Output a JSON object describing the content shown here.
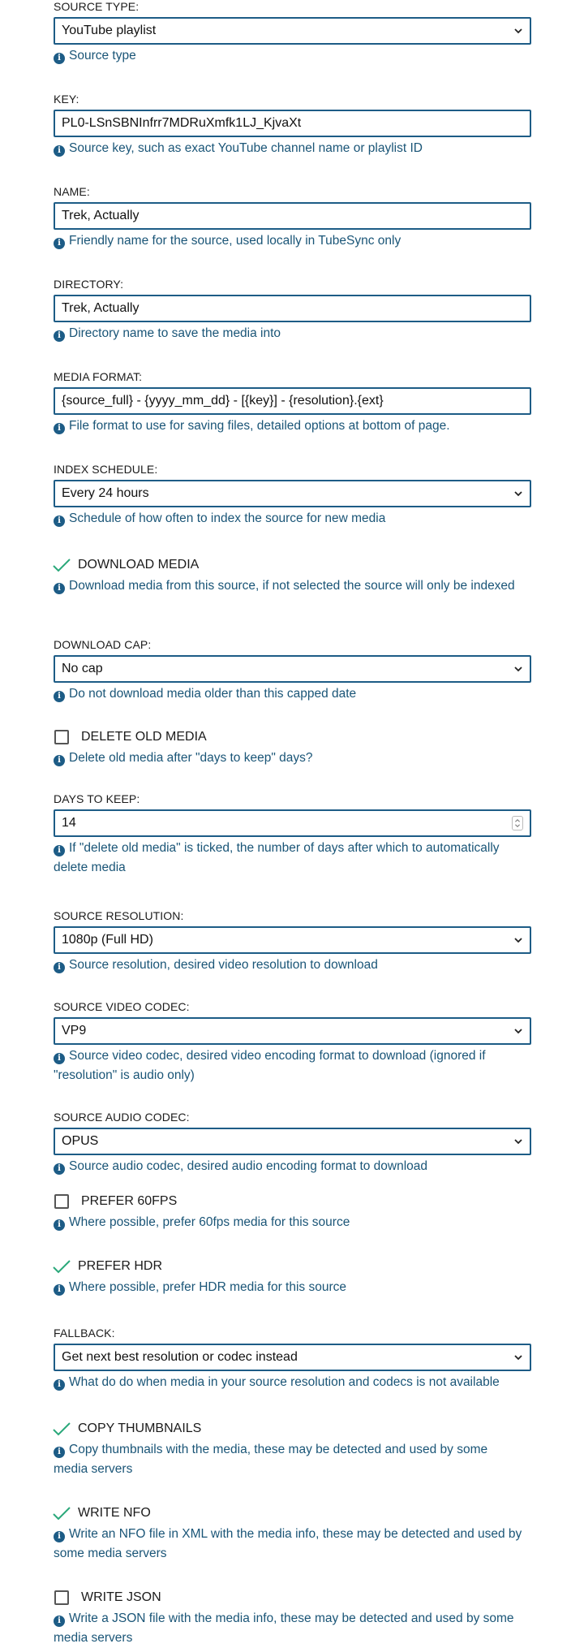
{
  "fields": {
    "source_type": {
      "label": "Source type:",
      "value": "YouTube playlist",
      "help": "Source type"
    },
    "key": {
      "label": "Key:",
      "value": "PL0-LSnSBNInfrr7MDRuXmfk1LJ_KjvaXt",
      "help": "Source key, such as exact YouTube channel name or playlist ID"
    },
    "name": {
      "label": "Name:",
      "value": "Trek, Actually",
      "help": "Friendly name for the source, used locally in TubeSync only"
    },
    "directory": {
      "label": "Directory:",
      "value": "Trek, Actually",
      "help": "Directory name to save the media into"
    },
    "media_format": {
      "label": "Media format:",
      "value": "{source_full} - {yyyy_mm_dd} - [{key}] - {resolution}.{ext}",
      "help": "File format to use for saving files, detailed options at bottom of page."
    },
    "index_schedule": {
      "label": "Index schedule:",
      "value": "Every 24 hours",
      "help": "Schedule of how often to index the source for new media"
    },
    "download_media": {
      "label": "Download media",
      "checked": true,
      "help": "Download media from this source, if not selected the source will only be indexed"
    },
    "download_cap": {
      "label": "Download cap:",
      "value": "No cap",
      "help": "Do not download media older than this capped date"
    },
    "delete_old_media": {
      "label": "Delete old media",
      "checked": false,
      "help": "Delete old media after \"days to keep\" days?"
    },
    "days_to_keep": {
      "label": "Days to keep:",
      "value": "14",
      "help": "If \"delete old media\" is ticked, the number of days after which to automatically delete media"
    },
    "source_resolution": {
      "label": "Source resolution:",
      "value": "1080p (Full HD)",
      "help": "Source resolution, desired video resolution to download"
    },
    "source_vcodec": {
      "label": "Source video codec:",
      "value": "VP9",
      "help": "Source video codec, desired video encoding format to download (ignored if \"resolution\" is audio only)"
    },
    "source_acodec": {
      "label": "Source audio codec:",
      "value": "OPUS",
      "help": "Source audio codec, desired audio encoding format to download"
    },
    "prefer_60fps": {
      "label": "Prefer 60fps",
      "checked": false,
      "help": "Where possible, prefer 60fps media for this source"
    },
    "prefer_hdr": {
      "label": "Prefer HDR",
      "checked": true,
      "help": "Where possible, prefer HDR media for this source"
    },
    "fallback": {
      "label": "Fallback:",
      "value": "Get next best resolution or codec instead",
      "help": "What do do when media in your source resolution and codecs is not available"
    },
    "copy_thumbnails": {
      "label": "Copy thumbnails",
      "checked": true,
      "help": "Copy thumbnails with the media, these may be detected and used by some media servers"
    },
    "write_nfo": {
      "label": "Write NFO",
      "checked": true,
      "help": "Write an NFO file in XML with the media info, these may be detected and used by some media servers"
    },
    "write_json": {
      "label": "Write JSON",
      "checked": false,
      "help": "Write a JSON file with the media info, these may be detected and used by some media servers"
    }
  },
  "icons": {
    "help": "info-circle-icon",
    "select": "chevron-down-icon",
    "checked": "checkmark-icon",
    "unchecked": "empty-checkbox-icon"
  },
  "colors": {
    "accent": "#1d5c86",
    "help_text": "#1a5577",
    "check": "#2aa87a"
  }
}
